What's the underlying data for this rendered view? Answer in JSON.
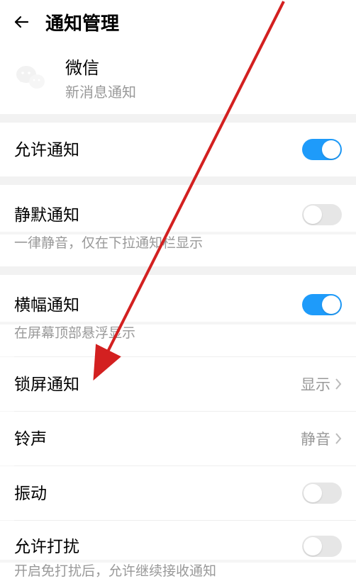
{
  "header": {
    "title": "通知管理"
  },
  "app": {
    "name": "微信",
    "subtitle": "新消息通知"
  },
  "rows": {
    "allowNotify": {
      "label": "允许通知"
    },
    "silent": {
      "label": "静默通知",
      "desc": "一律静音，仅在下拉通知栏显示"
    },
    "banner": {
      "label": "横幅通知",
      "desc": "在屏幕顶部悬浮显示"
    },
    "lockscreen": {
      "label": "锁屏通知",
      "value": "显示"
    },
    "ringtone": {
      "label": "铃声",
      "value": "静音"
    },
    "vibrate": {
      "label": "振动"
    },
    "disturb": {
      "label": "允许打扰",
      "desc": "开启免打扰后，允许继续接收通知"
    }
  }
}
